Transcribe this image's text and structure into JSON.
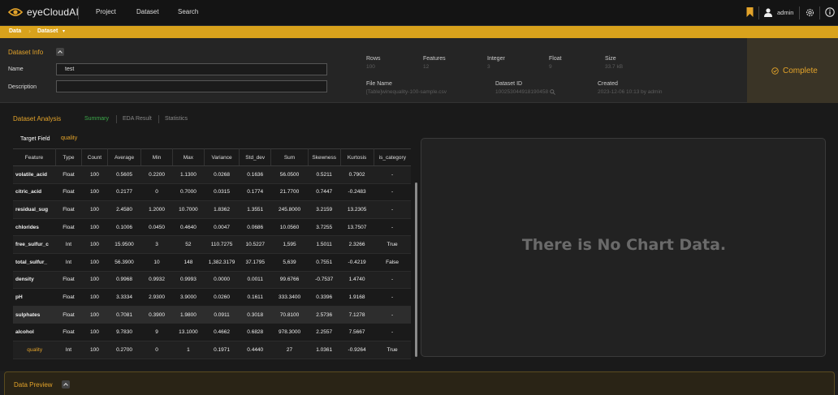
{
  "app": {
    "name": "eyeCloudAI"
  },
  "nav": {
    "items": [
      "Project",
      "Dataset",
      "Search"
    ],
    "user": "admin"
  },
  "breadcrumb": {
    "items": [
      "Data",
      "Dataset"
    ]
  },
  "dataset_info": {
    "title": "Dataset Info",
    "name_label": "Name",
    "name_value": "test",
    "description_label": "Description",
    "description_value": "",
    "meta": {
      "rows_label": "Rows",
      "rows_value": "100",
      "features_label": "Features",
      "features_value": "12",
      "integer_label": "Integer",
      "integer_value": "3",
      "float_label": "Float",
      "float_value": "9",
      "size_label": "Size",
      "size_value": "33.7 kB",
      "filename_label": "File Name",
      "filename_value": "[Table]winequality-100-sample.csv",
      "datasetid_label": "Dataset ID",
      "datasetid_value": "100253044918190458",
      "created_label": "Created",
      "created_value": "2023-12-06 10:13 by admin"
    },
    "status": "Complete"
  },
  "analysis": {
    "title": "Dataset Analysis",
    "tabs": [
      "Summary",
      "EDA Result",
      "Statistics"
    ],
    "active_tab": "Summary",
    "target_label": "Target Field",
    "target_value": "quality",
    "columns": [
      "Feature",
      "Type",
      "Count",
      "Average",
      "Min",
      "Max",
      "Variance",
      "Std_dev",
      "Sum",
      "Skewness",
      "Kurtosis",
      "is_category"
    ],
    "rows": [
      [
        "volatile_acid",
        "Float",
        "100",
        "0.5605",
        "0.2200",
        "1.1300",
        "0.0268",
        "0.1636",
        "56.0500",
        "0.5211",
        "0.7902",
        "-"
      ],
      [
        "citric_acid",
        "Float",
        "100",
        "0.2177",
        "0",
        "0.7000",
        "0.0315",
        "0.1774",
        "21.7700",
        "0.7447",
        "-0.2483",
        "-"
      ],
      [
        "residual_sug",
        "Float",
        "100",
        "2.4580",
        "1.2000",
        "10.7000",
        "1.8362",
        "1.3551",
        "245.8000",
        "3.2159",
        "13.2305",
        "-"
      ],
      [
        "chlorides",
        "Float",
        "100",
        "0.1006",
        "0.0450",
        "0.4640",
        "0.0047",
        "0.0686",
        "10.0560",
        "3.7255",
        "13.7507",
        "-"
      ],
      [
        "free_sulfur_c",
        "Int",
        "100",
        "15.9500",
        "3",
        "52",
        "110.7275",
        "10.5227",
        "1,595",
        "1.5011",
        "2.3266",
        "True"
      ],
      [
        "total_sulfur_",
        "Int",
        "100",
        "56.3900",
        "10",
        "148",
        "1,382.3179",
        "37.1795",
        "5,639",
        "0.7551",
        "-0.4219",
        "False"
      ],
      [
        "density",
        "Float",
        "100",
        "0.9968",
        "0.9932",
        "0.9993",
        "0.0000",
        "0.0011",
        "99.6766",
        "-0.7537",
        "1.4740",
        "-"
      ],
      [
        "pH",
        "Float",
        "100",
        "3.3334",
        "2.9300",
        "3.9000",
        "0.0260",
        "0.1611",
        "333.3400",
        "0.3396",
        "1.9168",
        "-"
      ],
      [
        "sulphates",
        "Float",
        "100",
        "0.7081",
        "0.3900",
        "1.9800",
        "0.0911",
        "0.3018",
        "70.8100",
        "2.5736",
        "7.1278",
        "-"
      ],
      [
        "alcohol",
        "Float",
        "100",
        "9.7830",
        "9",
        "13.1000",
        "0.4662",
        "0.6828",
        "978.3000",
        "2.2557",
        "7.5667",
        "-"
      ],
      [
        "quality",
        "Int",
        "100",
        "0.2700",
        "0",
        "1",
        "0.1971",
        "0.4440",
        "27",
        "1.0361",
        "-0.9264",
        "True"
      ]
    ],
    "chart_message": "There is No Chart Data."
  },
  "preview": {
    "title": "Data Preview"
  },
  "colors": {
    "accent": "#e3a32a",
    "breadcrumb_bg": "#d9a21c",
    "tab_active": "#3ba94a"
  }
}
